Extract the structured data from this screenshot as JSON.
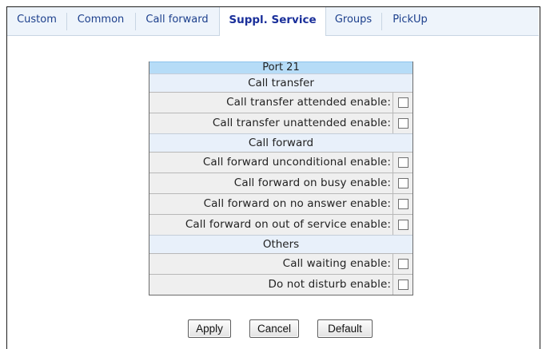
{
  "tabs": [
    {
      "label": "Custom"
    },
    {
      "label": "Common"
    },
    {
      "label": "Call forward"
    },
    {
      "label": "Suppl. Service",
      "active": true
    },
    {
      "label": "Groups"
    },
    {
      "label": "PickUp"
    }
  ],
  "panel": {
    "port_title": "Port 21",
    "sections": [
      {
        "title": "Call transfer",
        "rows": [
          {
            "label": "Call transfer attended enable:",
            "checked": false
          },
          {
            "label": "Call transfer unattended enable:",
            "checked": false
          }
        ]
      },
      {
        "title": "Call forward",
        "rows": [
          {
            "label": "Call forward unconditional enable:",
            "checked": false
          },
          {
            "label": "Call forward on busy enable:",
            "checked": false
          },
          {
            "label": "Call forward on no answer enable:",
            "checked": false
          },
          {
            "label": "Call forward on out of service enable:",
            "checked": false
          }
        ]
      },
      {
        "title": "Others",
        "rows": [
          {
            "label": "Call waiting enable:",
            "checked": false
          },
          {
            "label": "Do not disturb enable:",
            "checked": false
          }
        ]
      }
    ]
  },
  "buttons": {
    "apply": "Apply",
    "cancel": "Cancel",
    "default": "Default"
  }
}
